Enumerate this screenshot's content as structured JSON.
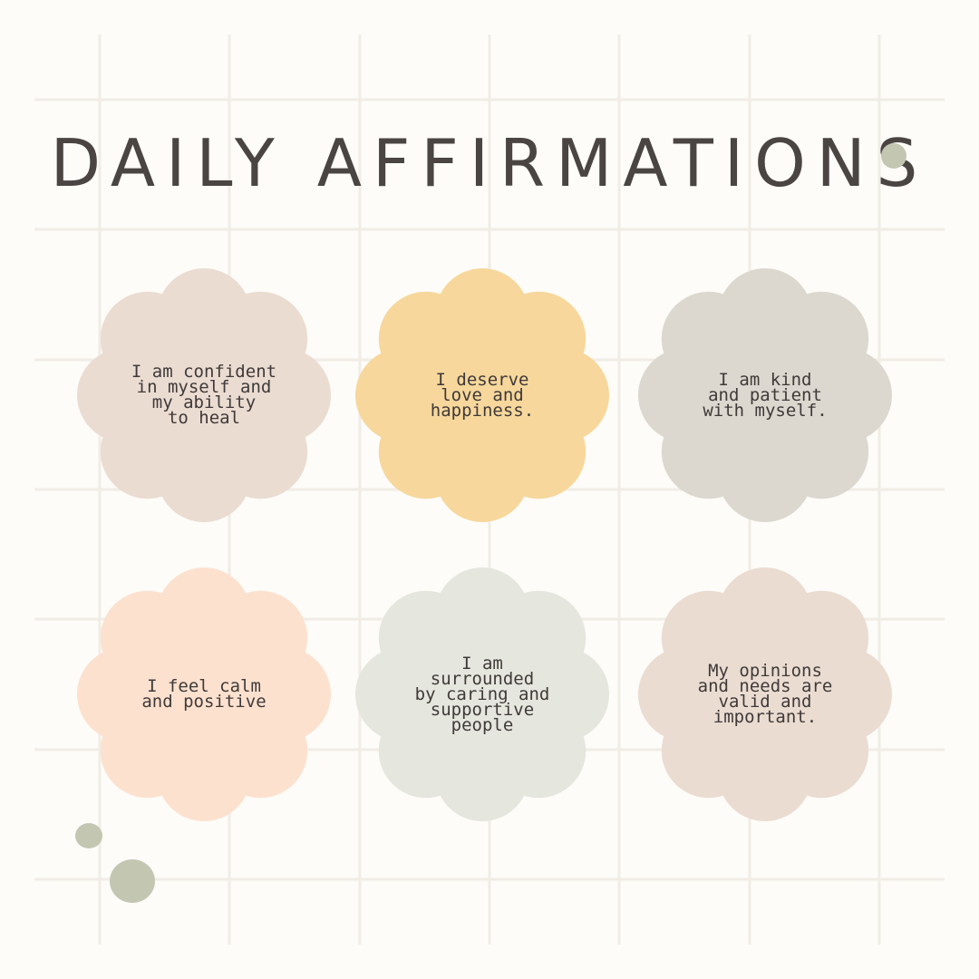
{
  "title": "DAILY AFFIRMATIONS",
  "colors": {
    "background": "#fdfcf8",
    "grid_line": "#f1ede6",
    "text": "#4a4543",
    "dot": "#c3c7b1"
  },
  "affirmations": [
    {
      "text": "I am confident\nin myself and\nmy ability\nto heal",
      "color": "#ebdcd2"
    },
    {
      "text": "I deserve\nlove and\nhappiness.",
      "color": "#f7d79c"
    },
    {
      "text": "I am kind\nand patient\nwith myself.",
      "color": "#dcd8cf"
    },
    {
      "text": "I feel calm\nand positive",
      "color": "#fde1cf"
    },
    {
      "text": "I am\nsurrounded\nby caring and\nsupportive\npeople",
      "color": "#e5e6dd"
    },
    {
      "text": "My opinions\nand needs are\nvalid and\nimportant.",
      "color": "#ebdcd2"
    }
  ]
}
